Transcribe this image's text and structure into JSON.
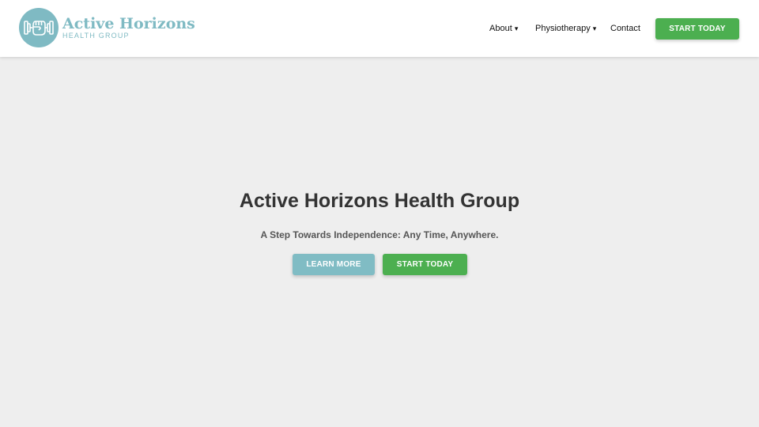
{
  "header": {
    "logo": {
      "title": "Active Horizons",
      "subtitle": "HEALTH GROUP",
      "icon": "fist-dumbbell-icon"
    },
    "nav": [
      {
        "label": "About",
        "has_dropdown": true,
        "caret": "▾"
      },
      {
        "label": "Physiotherapy",
        "has_dropdown": true,
        "caret": "▾"
      },
      {
        "label": "Contact",
        "has_dropdown": false,
        "caret": ""
      }
    ],
    "cta_label": "START TODAY"
  },
  "hero": {
    "title": "Active Horizons Health Group",
    "subtitle": "A Step Towards Independence: Any Time, Anywhere.",
    "learn_more_label": "LEARN MORE",
    "start_today_label": "START TODAY"
  },
  "colors": {
    "brand_teal": "#7fbac3",
    "cta_green": "#4caf50",
    "page_background": "#eeeeee",
    "header_background": "#ffffff"
  }
}
